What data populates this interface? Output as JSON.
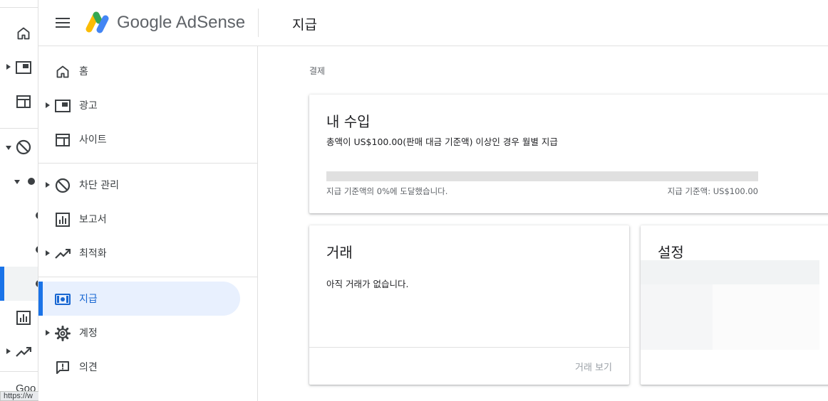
{
  "colors": {
    "accent": "#1a73e8",
    "active_bg": "#e8f0fe",
    "active_text": "#1967d2",
    "progress_track": "#e0e0e0",
    "logo_yellow": "#fbbc04",
    "logo_green": "#34a853",
    "logo_blue": "#4285f4"
  },
  "rail": {
    "icons": [
      "home-icon",
      "ads-icon",
      "sites-icon",
      "block-icon",
      "dot-icon",
      "dot-icon",
      "dot-icon",
      "reports-icon",
      "optimization-icon"
    ],
    "footer_text": "Goo",
    "status_url": "https://w"
  },
  "header": {
    "brand": "Google AdSense",
    "page_title": "지급"
  },
  "sidebar": {
    "items": [
      {
        "label": "홈",
        "icon": "home-icon",
        "expandable": false
      },
      {
        "label": "광고",
        "icon": "ads-icon",
        "expandable": true
      },
      {
        "label": "사이트",
        "icon": "sites-icon",
        "expandable": false
      },
      {
        "label": "차단 관리",
        "icon": "block-icon",
        "expandable": true
      },
      {
        "label": "보고서",
        "icon": "reports-icon",
        "expandable": false
      },
      {
        "label": "최적화",
        "icon": "optimization-icon",
        "expandable": true
      },
      {
        "label": "지급",
        "icon": "payments-icon",
        "expandable": false,
        "active": true
      },
      {
        "label": "계정",
        "icon": "gear-icon",
        "expandable": true
      },
      {
        "label": "의견",
        "icon": "feedback-icon",
        "expandable": false
      }
    ]
  },
  "main": {
    "breadcrumb": "결제",
    "earnings": {
      "title": "내 수입",
      "description": "총액이 US$100.00(판매 대금 기준액) 이상인 경우 월별 지급",
      "progress_percent": 0,
      "progress_left": "지급 기준액의 0%에 도달했습니다.",
      "progress_right": "지급 기준액: US$100.00"
    },
    "transactions": {
      "title": "거래",
      "empty_text": "아직 거래가 없습니다.",
      "view_button": "거래 보기"
    },
    "settings": {
      "title": "설정"
    }
  }
}
